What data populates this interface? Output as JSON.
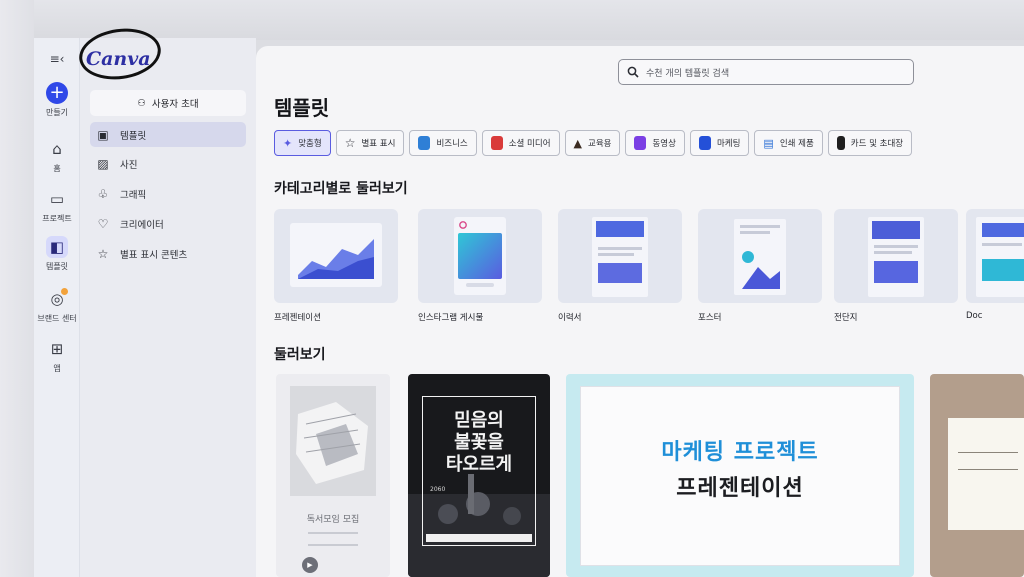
{
  "rail": {
    "create_label": "만들기",
    "home_label": "홈",
    "projects_label": "프로젝트",
    "templates_label": "템플릿",
    "brand_label": "브랜드 센터",
    "apps_label": "앱"
  },
  "sidebar": {
    "logo": "Canva",
    "invite_label": "사용자 초대",
    "items": [
      {
        "label": "템플릿",
        "icon": "template-icon"
      },
      {
        "label": "사진",
        "icon": "photo-icon"
      },
      {
        "label": "그래픽",
        "icon": "graphic-icon"
      },
      {
        "label": "크리에이터",
        "icon": "creator-icon"
      },
      {
        "label": "별표 표시 콘텐츠",
        "icon": "star-icon"
      }
    ]
  },
  "search": {
    "placeholder": "수천 개의 템플릿 검색"
  },
  "page_title": "템플릿",
  "chips": [
    {
      "label": "맞춤형",
      "color": "#5a5ce0"
    },
    {
      "label": "별표 표시",
      "color": "#333333"
    },
    {
      "label": "비즈니스",
      "color": "#2f7fd6"
    },
    {
      "label": "소셜 미디어",
      "color": "#d93a3a"
    },
    {
      "label": "교육용",
      "color": "#3b2b21"
    },
    {
      "label": "동영상",
      "color": "#7b3fe4"
    },
    {
      "label": "마케팅",
      "color": "#2450d8"
    },
    {
      "label": "인쇄 제품",
      "color": "#2a6fd6"
    },
    {
      "label": "카드 및 초대장",
      "color": "#1f1f1f"
    }
  ],
  "categories_title": "카테고리별로 둘러보기",
  "categories": [
    {
      "label": "프레젠테이션"
    },
    {
      "label": "인스타그램 게시물"
    },
    {
      "label": "이력서"
    },
    {
      "label": "포스터"
    },
    {
      "label": "전단지"
    },
    {
      "label": "Doc"
    }
  ],
  "browse_title": "둘러보기",
  "browse": {
    "card1_title": "독서모임 모집",
    "card2_lines": [
      "믿음의",
      "불꽃을",
      "타오르게"
    ],
    "card2_sub": "2060",
    "card3_line1": "마케팅 프로젝트",
    "card3_line2": "프레젠테이션"
  },
  "colors": {
    "accent": "#2f48e8",
    "brand": "#2d2fa3",
    "card3_blue": "#1f8fd8"
  }
}
